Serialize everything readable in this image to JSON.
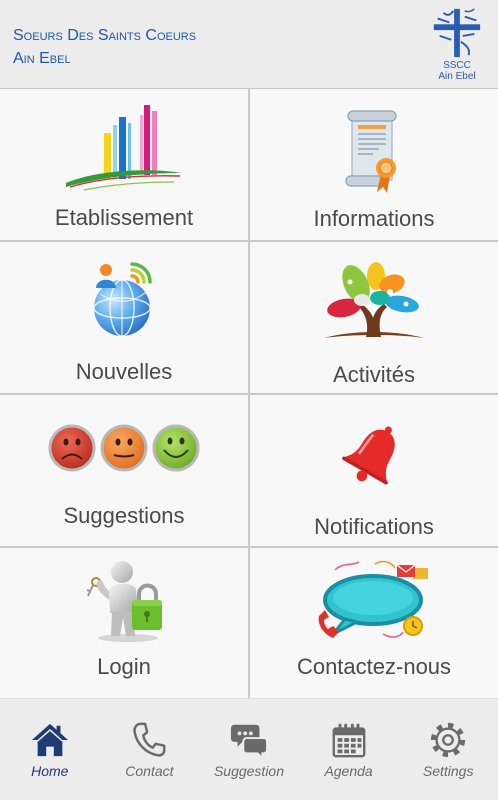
{
  "header": {
    "title_line1": "Soeurs Des Saints Coeurs",
    "title_line2": "Ain Ebel",
    "logo": {
      "icon": "sscc-cross-logo",
      "text_line1": "SSCC",
      "text_line2": "Ain Ebel"
    }
  },
  "tiles": [
    {
      "label": "Etablissement",
      "icon": "school-bars-icon"
    },
    {
      "label": "Informations",
      "icon": "certificate-scroll-icon"
    },
    {
      "label": "Nouvelles",
      "icon": "news-globe-icon"
    },
    {
      "label": "Activités",
      "icon": "activity-tree-icon"
    },
    {
      "label": "Suggestions",
      "icon": "smiley-faces-icon"
    },
    {
      "label": "Notifications",
      "icon": "bell-icon"
    },
    {
      "label": "Login",
      "icon": "login-keys-lock-icon"
    },
    {
      "label": "Contactez-nous",
      "icon": "contact-phone-bubble-icon"
    }
  ],
  "nav": {
    "items": [
      {
        "label": "Home",
        "icon": "home-icon",
        "active": true
      },
      {
        "label": "Contact",
        "icon": "phone-icon",
        "active": false
      },
      {
        "label": "Suggestion",
        "icon": "chat-bubbles-icon",
        "active": false
      },
      {
        "label": "Agenda",
        "icon": "calendar-icon",
        "active": false
      },
      {
        "label": "Settings",
        "icon": "gear-icon",
        "active": false
      }
    ]
  },
  "colors": {
    "header_text": "#1e57aa",
    "tile_label": "#4a4a4a",
    "nav_active": "#1f3b73",
    "nav_inactive": "#6a6a6a",
    "background": "#ececec"
  }
}
